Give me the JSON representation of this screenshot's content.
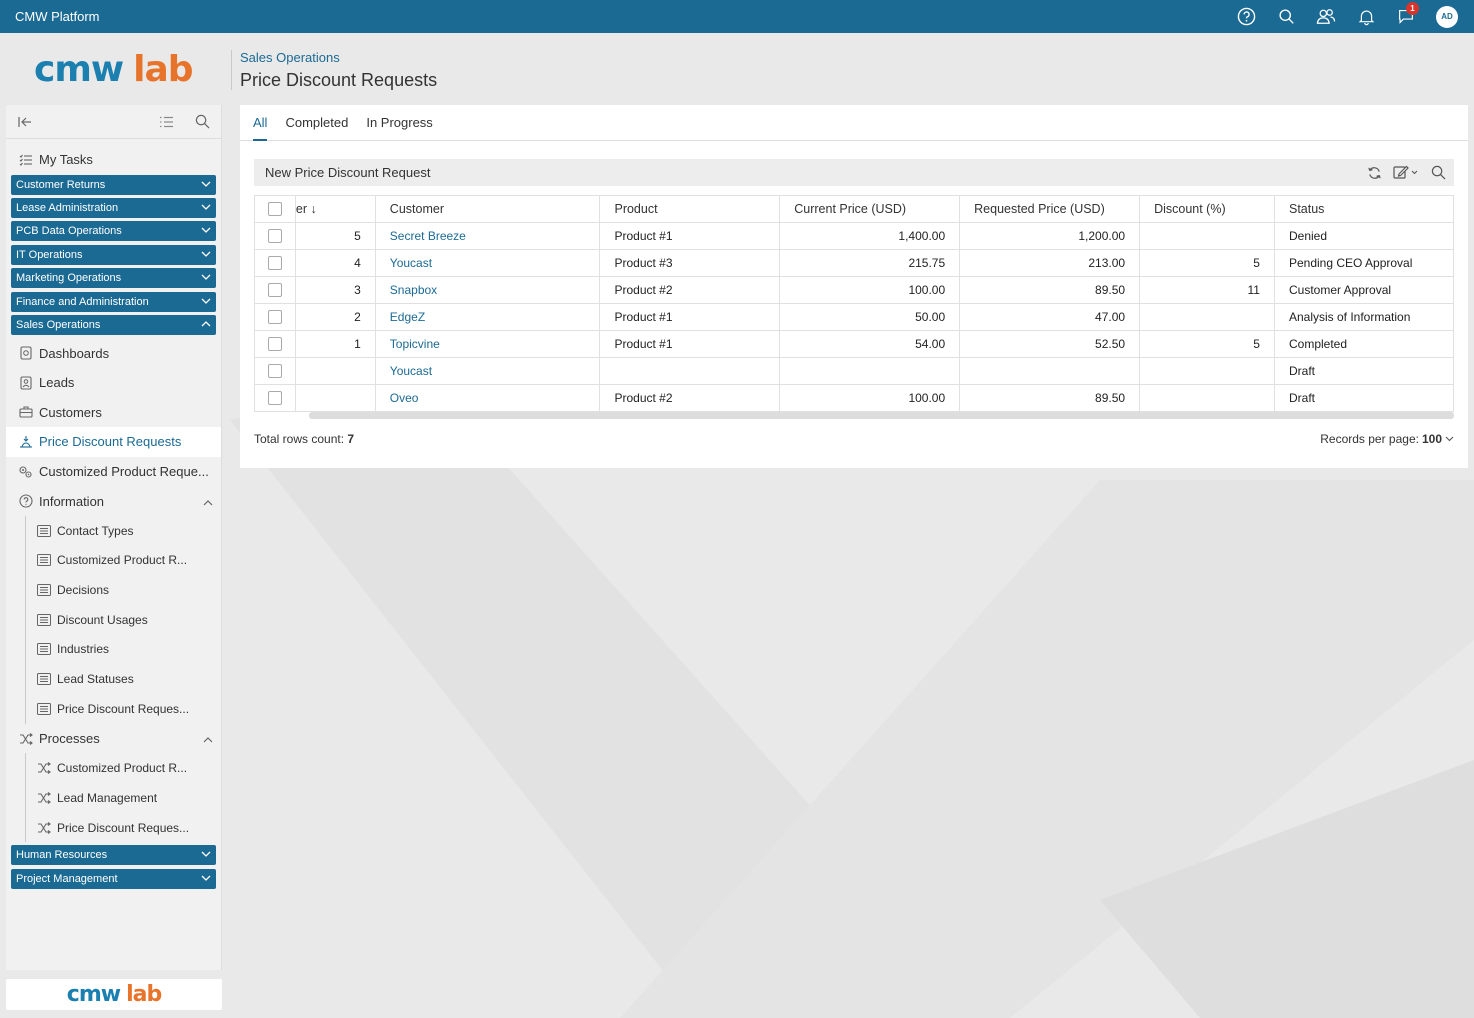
{
  "topbar": {
    "app_title": "CMW Platform",
    "notification_count": "1",
    "avatar_initials": "AD",
    "icons": [
      "help-icon",
      "search-icon",
      "users-icon",
      "bell-icon",
      "chat-icon"
    ]
  },
  "logo": {
    "part1": "cmw",
    "part2": "lab"
  },
  "header": {
    "breadcrumb": "Sales Operations",
    "title": "Price Discount Requests"
  },
  "sidebar": {
    "my_tasks": "My Tasks",
    "groups_top": [
      "Customer Returns",
      "Lease Administration",
      "PCB Data Operations",
      "IT Operations",
      "Marketing Operations",
      "Finance and Administration",
      "Sales Operations"
    ],
    "sales_items": [
      "Dashboards",
      "Leads",
      "Customers",
      "Price Discount Requests",
      "Customized Product Reque..."
    ],
    "information": {
      "label": "Information",
      "items": [
        "Contact Types",
        "Customized Product R...",
        "Decisions",
        "Discount Usages",
        "Industries",
        "Lead Statuses",
        "Price Discount Reques..."
      ]
    },
    "processes": {
      "label": "Processes",
      "items": [
        "Customized Product R...",
        "Lead Management",
        "Price Discount Reques..."
      ]
    },
    "groups_bottom": [
      "Human Resources",
      "Project Management"
    ]
  },
  "tabs": [
    "All",
    "Completed",
    "In Progress"
  ],
  "toolbar": {
    "new_button": "New Price Discount Request"
  },
  "table": {
    "columns": [
      "                                                               er ↓",
      "Customer",
      "Product",
      "Current Price (USD)",
      "Requested Price (USD)",
      "Discount (%)",
      "Status"
    ],
    "rows": [
      [
        "5",
        "Secret Breeze",
        "Product #1",
        "1,400.00",
        "1,200.00",
        "",
        "Denied"
      ],
      [
        "4",
        "Youcast",
        "Product #3",
        "215.75",
        "213.00",
        "5",
        "Pending CEO Approval"
      ],
      [
        "3",
        "Snapbox",
        "Product #2",
        "100.00",
        "89.50",
        "11",
        "Customer Approval"
      ],
      [
        "2",
        "EdgeZ",
        "Product #1",
        "50.00",
        "47.00",
        "",
        "Analysis of Information"
      ],
      [
        "1",
        "Topicvine",
        "Product #1",
        "54.00",
        "52.50",
        "5",
        "Completed"
      ],
      [
        "",
        "Youcast",
        "",
        "",
        "",
        "",
        "Draft"
      ],
      [
        "",
        "Oveo",
        "Product #2",
        "100.00",
        "89.50",
        "",
        "Draft"
      ]
    ]
  },
  "footer": {
    "total_label": "Total rows count:",
    "total_value": "7",
    "per_page_label": "Records per page:",
    "per_page_value": "100"
  }
}
